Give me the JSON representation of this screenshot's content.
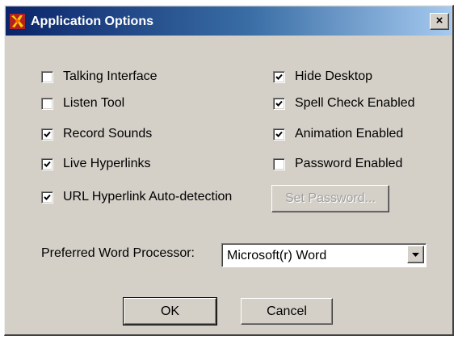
{
  "window": {
    "title": "Application Options",
    "close_glyph": "×"
  },
  "options": {
    "left": [
      {
        "label": "Talking Interface",
        "checked": false
      },
      {
        "label": "Listen Tool",
        "checked": false
      },
      {
        "label": "Record Sounds",
        "checked": true
      },
      {
        "label": "Live Hyperlinks",
        "checked": true
      },
      {
        "label": "URL Hyperlink Auto-detection",
        "checked": true
      }
    ],
    "right": [
      {
        "label": "Hide Desktop",
        "checked": true
      },
      {
        "label": "Spell Check Enabled",
        "checked": true
      },
      {
        "label": "Animation Enabled",
        "checked": true
      },
      {
        "label": "Password Enabled",
        "checked": false
      }
    ]
  },
  "set_password_button": {
    "label": "Set Password...",
    "enabled": false
  },
  "word_processor": {
    "label": "Preferred Word Processor:",
    "selected": "Microsoft(r) Word"
  },
  "buttons": {
    "ok_label": "OK",
    "cancel_label": "Cancel"
  },
  "colors": {
    "title_gradient_start": "#0a246a",
    "title_gradient_end": "#a6caf0",
    "dialog_face": "#d4d0c8",
    "disabled_text": "#a0a0a0"
  }
}
